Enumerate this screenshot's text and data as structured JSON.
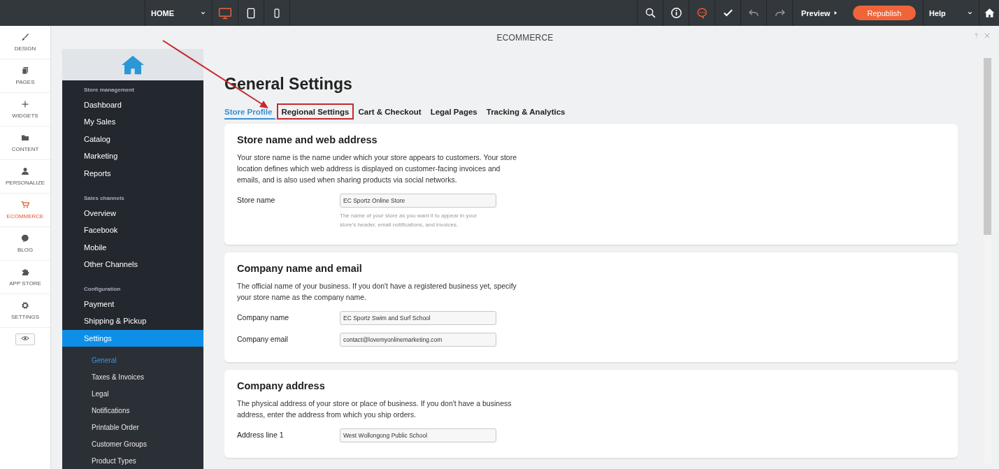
{
  "toolbar": {
    "page_select": {
      "value": "HOME"
    },
    "devices": [
      {
        "selected": true
      },
      {
        "selected": false
      },
      {
        "selected": false
      }
    ],
    "preview": "Preview",
    "republish": "Republish",
    "help": "Help"
  },
  "rail": {
    "items": [
      {
        "label": "DESIGN",
        "selected": false
      },
      {
        "label": "PAGES",
        "selected": false
      },
      {
        "label": "WIDGETS",
        "selected": false
      },
      {
        "label": "CONTENT",
        "selected": false
      },
      {
        "label": "PERSONALIZE",
        "selected": false
      },
      {
        "label": "ECOMMERCE",
        "selected": true
      },
      {
        "label": "BLOG",
        "selected": false
      },
      {
        "label": "APP STORE",
        "selected": false
      },
      {
        "label": "SETTINGS",
        "selected": false
      }
    ]
  },
  "panel": {
    "title": "ECOMMERCE"
  },
  "store_nav": {
    "sections": [
      {
        "heading": "Store management",
        "items": [
          {
            "label": "Dashboard",
            "selected": false
          },
          {
            "label": "My Sales",
            "selected": false
          },
          {
            "label": "Catalog",
            "selected": false
          },
          {
            "label": "Marketing",
            "selected": false
          },
          {
            "label": "Reports",
            "selected": false
          }
        ]
      },
      {
        "heading": "Sales channels",
        "items": [
          {
            "label": "Overview",
            "selected": false
          },
          {
            "label": "Facebook",
            "selected": false
          },
          {
            "label": "Mobile",
            "selected": false
          },
          {
            "label": "Other Channels",
            "selected": false
          }
        ]
      },
      {
        "heading": "Configuration",
        "items": [
          {
            "label": "Payment",
            "selected": false
          },
          {
            "label": "Shipping & Pickup",
            "selected": false
          },
          {
            "label": "Settings",
            "selected": true,
            "children": [
              {
                "label": "General",
                "selected": true
              },
              {
                "label": "Taxes & Invoices",
                "selected": false
              },
              {
                "label": "Legal",
                "selected": false
              },
              {
                "label": "Notifications",
                "selected": false
              },
              {
                "label": "Printable Order",
                "selected": false
              },
              {
                "label": "Customer Groups",
                "selected": false
              },
              {
                "label": "Product Types",
                "selected": false
              }
            ]
          }
        ]
      }
    ]
  },
  "content": {
    "title": "General Settings",
    "tabs": [
      {
        "label": "Store Profile",
        "selected": true,
        "highlighted": false
      },
      {
        "label": "Regional Settings",
        "selected": false,
        "highlighted": true
      },
      {
        "label": "Cart & Checkout",
        "selected": false,
        "highlighted": false
      },
      {
        "label": "Legal Pages",
        "selected": false,
        "highlighted": false
      },
      {
        "label": "Tracking & Analytics",
        "selected": false,
        "highlighted": false
      }
    ],
    "cards": [
      {
        "title": "Store name and web address",
        "description": "Your store name is the name under which your store appears to customers. Your store location defines which web address is displayed on customer-facing invoices and emails, and is also used when sharing products via social networks.",
        "fields": [
          {
            "label": "Store name",
            "value": "EC Sportz Online Store",
            "help": "The name of your store as you want it to appear in your store's header, email notifications, and invoices."
          }
        ]
      },
      {
        "title": "Company name and email",
        "description": "The official name of your business. If you don't have a registered business yet, specify your store name as the company name.",
        "fields": [
          {
            "label": "Company name",
            "value": "EC Sportz Swim and Surf School"
          },
          {
            "label": "Company email",
            "value": "contact@lovemyonlinemarketing.com"
          }
        ]
      },
      {
        "title": "Company address",
        "description": "The physical address of your store or place of business. If you don't have a business address, enter the address from which you ship orders.",
        "fields": [
          {
            "label": "Address line 1",
            "value": "West Wollongong Public School"
          }
        ]
      }
    ]
  }
}
